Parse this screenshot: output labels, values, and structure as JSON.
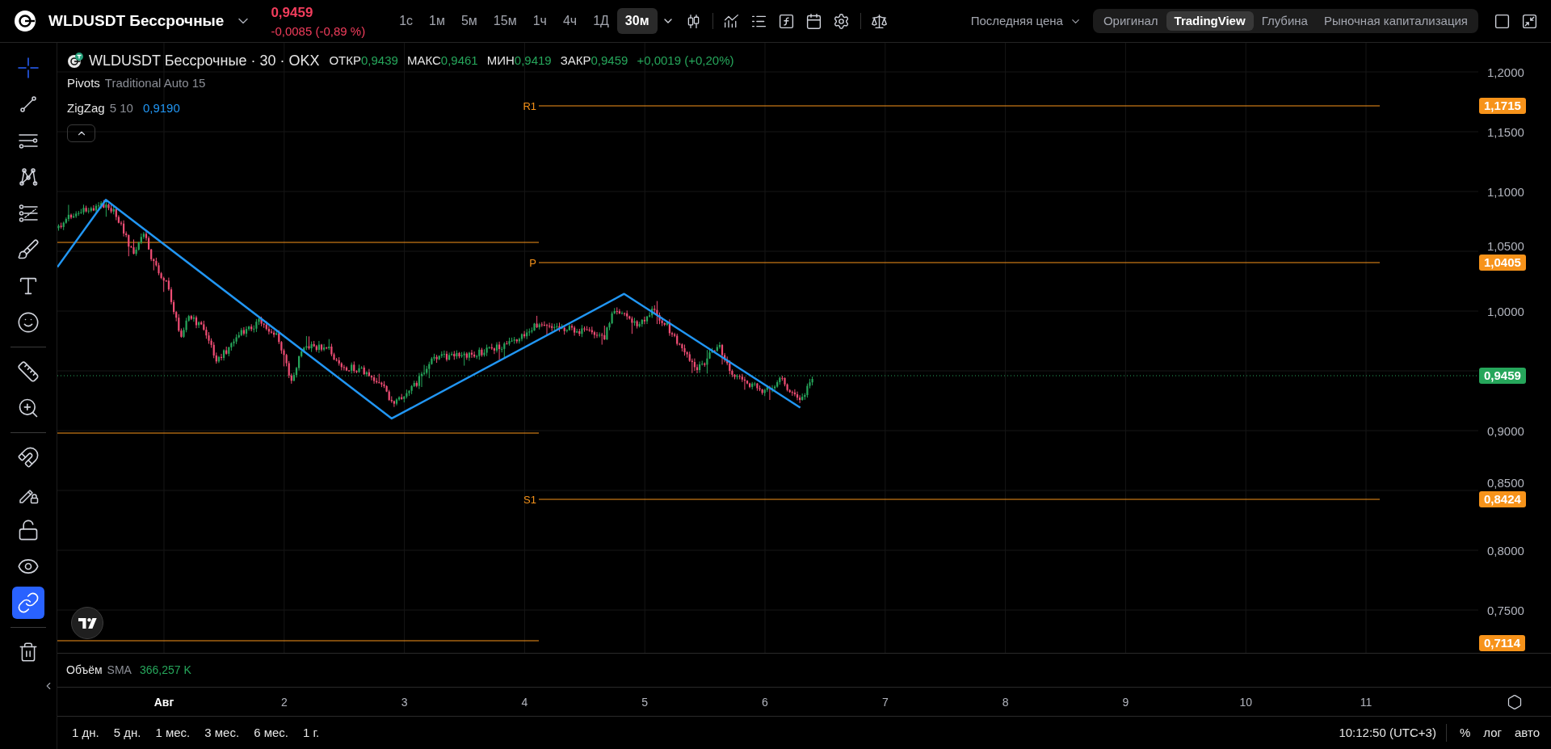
{
  "header": {
    "symbol": "WLDUSDT Бессрочные",
    "price": "0,9459",
    "change": "-0,0085 (-0,89 %)",
    "intervals": [
      {
        "label": "1с",
        "selected": false
      },
      {
        "label": "1м",
        "selected": false
      },
      {
        "label": "5м",
        "selected": false
      },
      {
        "label": "15м",
        "selected": false
      },
      {
        "label": "1ч",
        "selected": false
      },
      {
        "label": "4ч",
        "selected": false
      },
      {
        "label": "1Д",
        "selected": false
      },
      {
        "label": "30м",
        "selected": true
      }
    ],
    "price_source": "Последняя цена",
    "views": [
      {
        "label": "Оригинал",
        "selected": false
      },
      {
        "label": "TradingView",
        "selected": true
      },
      {
        "label": "Глубина",
        "selected": false
      },
      {
        "label": "Рыночная капитализация",
        "selected": false
      }
    ]
  },
  "toolbar": {
    "tools": [
      {
        "selected": true
      },
      {
        "selected": false
      },
      {
        "selected": false
      },
      {
        "selected": false
      },
      {
        "selected": false
      },
      {
        "selected": false
      },
      {
        "selected": false
      },
      {
        "selected": false
      },
      {
        "selected": false
      },
      {
        "selected": false
      }
    ],
    "toggles": [
      {
        "on": false
      },
      {
        "on": false
      },
      {
        "on": false
      },
      {
        "on": false
      },
      {
        "on": true
      }
    ]
  },
  "legend": {
    "title": "WLDUSDT Бессрочные · 30 · OKX",
    "ohlc": [
      {
        "label": "ОТКР",
        "value": "0,9439"
      },
      {
        "label": "МАКС",
        "value": "0,9461"
      },
      {
        "label": "МИН",
        "value": "0,9419"
      },
      {
        "label": "ЗАКР",
        "value": "0,9459"
      }
    ],
    "change": "+0,0019 (+0,20%)",
    "indicators": [
      {
        "name": "Pivots",
        "params": "Traditional Auto 15"
      },
      {
        "name": "ZigZag",
        "params": "5 10",
        "value": "0,9190"
      }
    ]
  },
  "chart": {
    "pivots": [
      {
        "label": "R1"
      },
      {
        "label": "P"
      },
      {
        "label": "S1"
      }
    ]
  },
  "price_axis": {
    "ticks": [
      "1,2000",
      "1,1500",
      "1,1000",
      "1,0500",
      "1,0000",
      "0,9000",
      "0,8500",
      "0,8000",
      "0,7500"
    ],
    "badges": [
      {
        "text": "1,1715",
        "color": "#f7931a"
      },
      {
        "text": "1,0405",
        "color": "#f7931a"
      },
      {
        "text": "0,9459",
        "color": "#26a65b"
      },
      {
        "text": "0,8424",
        "color": "#f7931a"
      },
      {
        "text": "0,7114",
        "color": "#f7931a"
      }
    ]
  },
  "volume": {
    "name": "Объём",
    "indicator": "SMA",
    "value": "366,257 K"
  },
  "time_axis": [
    {
      "text": "Авг",
      "kind": "month"
    },
    {
      "text": "2",
      "kind": "day"
    },
    {
      "text": "3",
      "kind": "day"
    },
    {
      "text": "4",
      "kind": "day"
    },
    {
      "text": "5",
      "kind": "day"
    },
    {
      "text": "6",
      "kind": "day"
    },
    {
      "text": "7",
      "kind": "day"
    },
    {
      "text": "8",
      "kind": "day"
    },
    {
      "text": "9",
      "kind": "day"
    },
    {
      "text": "10",
      "kind": "day"
    },
    {
      "text": "11",
      "kind": "day"
    }
  ],
  "bottom_bar": {
    "ranges": [
      "1 дн.",
      "5 дн.",
      "1 мес.",
      "3 мес.",
      "6 мес.",
      "1 г."
    ],
    "clock": "10:12:50 (UTC+3)",
    "scale_modes": [
      "%",
      "лог",
      "авто"
    ]
  }
}
